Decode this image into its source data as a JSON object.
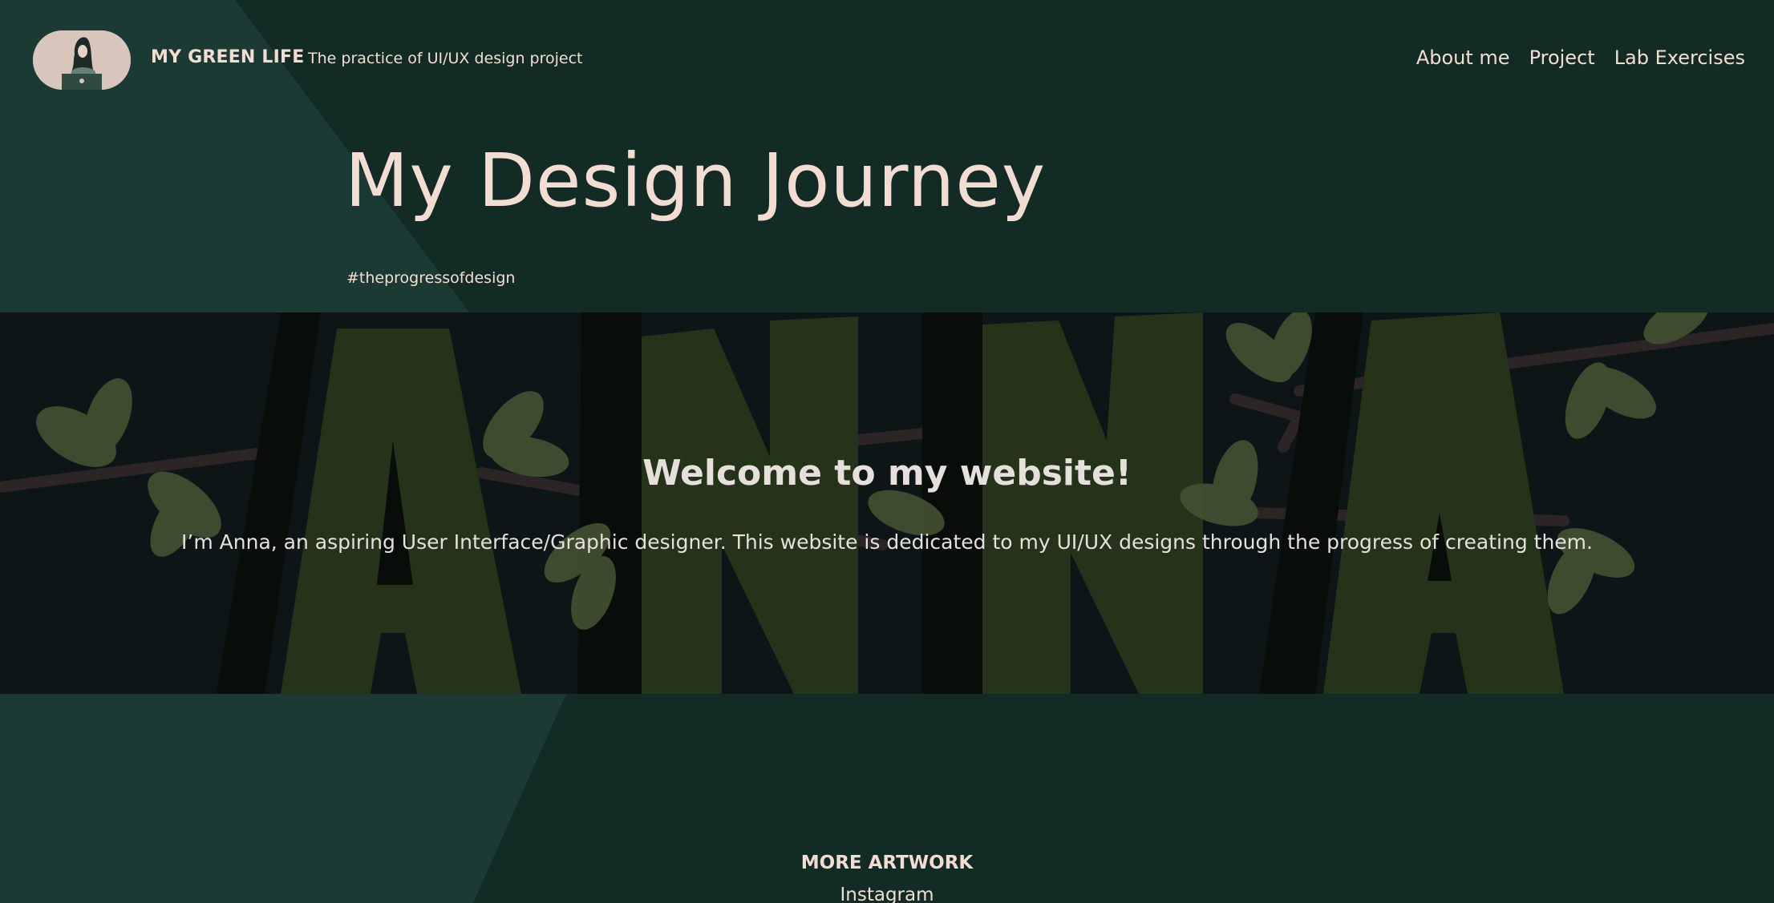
{
  "header": {
    "brand": "MY GREEN LIFE",
    "tagline": "The practice of UI/UX design project",
    "nav": [
      {
        "label": "About me"
      },
      {
        "label": "Project"
      },
      {
        "label": "Lab Exercises"
      }
    ]
  },
  "hero": {
    "title": "My Design Journey",
    "hashtag": "#theprogressofdesign"
  },
  "banner": {
    "title": "Welcome to my website!",
    "text": "I’m Anna, an aspiring User Interface/Graphic designer. This website is dedicated to my UI/UX designs through the progress of creating them.",
    "background_word": "ANNA"
  },
  "footer": {
    "section_title": "MORE ARTWORK",
    "link": "Instagram"
  },
  "colors": {
    "page_bg": "#132b25",
    "band_light": "#1b3a33",
    "text_cream": "#f3ddd2",
    "banner_bg": "#0f1719",
    "letter_green": "#2b3a1e",
    "leaf_green": "#4f5e3a"
  }
}
